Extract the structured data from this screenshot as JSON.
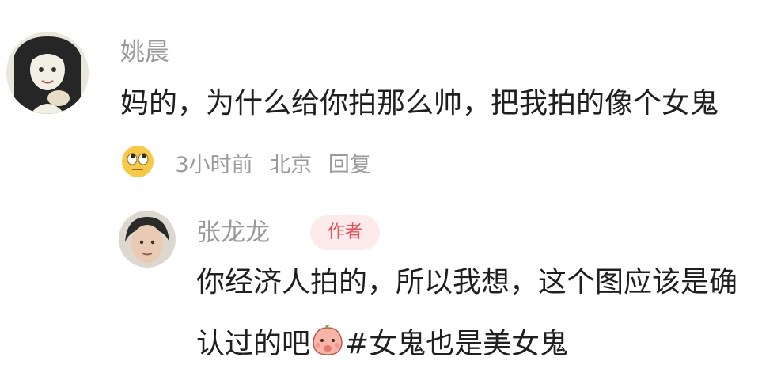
{
  "comments": [
    {
      "author": "姚晨",
      "text": "妈的，为什么给你拍那么帅，把我拍的像个女鬼",
      "emoji": "eye-roll-emoji",
      "meta": {
        "time": "3小时前",
        "location": "北京",
        "reply": "回复"
      }
    },
    {
      "author": "张龙龙",
      "badge": "作者",
      "text_before": "你经济人拍的，所以我想，这个图应该是确认过的吧",
      "emoji": "peach-face-emoji",
      "text_after": "#女鬼也是美女鬼"
    }
  ],
  "colors": {
    "meta": "#9a9a9a",
    "text": "#1f1f1f",
    "badge_bg": "#fdeaea",
    "badge_text": "#e8505b"
  }
}
